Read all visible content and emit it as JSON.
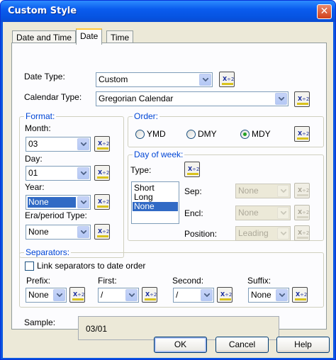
{
  "window": {
    "title": "Custom Style",
    "close": "✕"
  },
  "tabs": [
    {
      "label": "Date and Time"
    },
    {
      "label": "Date"
    },
    {
      "label": "Time"
    }
  ],
  "date_type": {
    "label": "Date Type:",
    "value": "Custom"
  },
  "calendar_type": {
    "label": "Calendar Type:",
    "value": "Gregorian Calendar"
  },
  "format": {
    "title": "Format:",
    "month": {
      "label": "Month:",
      "value": "03"
    },
    "day": {
      "label": "Day:",
      "value": "01"
    },
    "year": {
      "label": "Year:",
      "value": "None"
    },
    "era": {
      "label": "Era/period Type:",
      "value": "None"
    }
  },
  "order": {
    "title": "Order:",
    "options": [
      {
        "label": "YMD",
        "selected": false
      },
      {
        "label": "DMY",
        "selected": false
      },
      {
        "label": "MDY",
        "selected": true
      }
    ]
  },
  "day_of_week": {
    "title": "Day of week:",
    "type_label": "Type:",
    "type_items": [
      "Short",
      "Long",
      "None"
    ],
    "selected_type": "None",
    "sep": {
      "label": "Sep:",
      "value": "None"
    },
    "encl": {
      "label": "Encl:",
      "value": "None"
    },
    "position": {
      "label": "Position:",
      "value": "Leading"
    }
  },
  "separators": {
    "title": "Separators:",
    "link_label": "Link separators to date order",
    "link_checked": false,
    "prefix": {
      "label": "Prefix:",
      "value": "None"
    },
    "first": {
      "label": "First:",
      "value": "/"
    },
    "second": {
      "label": "Second:",
      "value": "/"
    },
    "suffix": {
      "label": "Suffix:",
      "value": "None"
    }
  },
  "sample": {
    "label": "Sample:",
    "value": "03/01"
  },
  "buttons": {
    "ok": "OK",
    "cancel": "Cancel",
    "help": "Help"
  },
  "icons": {
    "formula": "formula-xy2-icon",
    "dropdown": "chevron-down-icon"
  },
  "colors": {
    "title_bar": "#0A5CEE",
    "dialog_bg": "#ECE9D8",
    "panel_bg": "#FCFCFE",
    "selection": "#316AC5",
    "group_title": "#0046D5",
    "radio_dot": "#21A121"
  }
}
